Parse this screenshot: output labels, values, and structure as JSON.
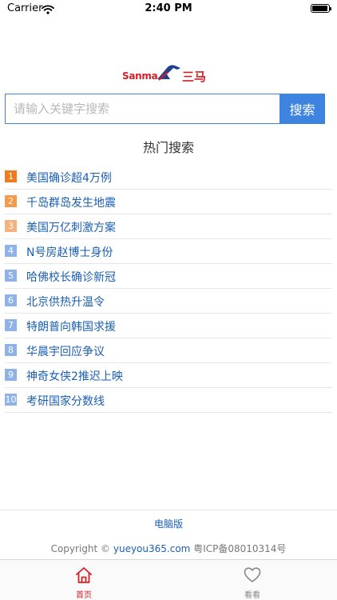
{
  "status_bar": {
    "carrier": "Carrier",
    "time": "2:40 PM",
    "icons": [
      "wifi-icon",
      "battery-icon"
    ]
  },
  "logo": {
    "text_en": "Sanma",
    "text_cn": "三马",
    "icon": "horse-icon",
    "color": "#d61f26"
  },
  "search": {
    "placeholder": "请输入关键字搜索",
    "value": "",
    "button_label": "搜索",
    "accent_color": "#3d83e0"
  },
  "hot_title": "热门搜索",
  "hot_searches": [
    {
      "rank": "1",
      "label": "美国确诊超4万例",
      "color": "#f07a1c"
    },
    {
      "rank": "2",
      "label": "千岛群岛发生地震",
      "color": "#f49a4a"
    },
    {
      "rank": "3",
      "label": "美国万亿刺激方案",
      "color": "#f6b27a"
    },
    {
      "rank": "4",
      "label": "N号房赵博士身份",
      "color": "#8fb3e8"
    },
    {
      "rank": "5",
      "label": "哈佛校长确诊新冠",
      "color": "#8fb3e8"
    },
    {
      "rank": "6",
      "label": "北京供热升温令",
      "color": "#8fb3e8"
    },
    {
      "rank": "7",
      "label": "特朗普向韩国求援",
      "color": "#8fb3e8"
    },
    {
      "rank": "8",
      "label": "华晨宇回应争议",
      "color": "#8fb3e8"
    },
    {
      "rank": "9",
      "label": "神奇女侠2推迟上映",
      "color": "#8fb3e8"
    },
    {
      "rank": "10",
      "label": "考研国家分数线",
      "color": "#8fb3e8"
    }
  ],
  "footer": {
    "pc_version": "电脑版",
    "copyright_prefix": "Copyright ©",
    "site": "yueyou365.com",
    "icp": "粤ICP备08010314号"
  },
  "tab_bar": {
    "tabs": [
      {
        "label": "首页",
        "icon": "home-icon",
        "active": true,
        "color": "#d61f26"
      },
      {
        "label": "看看",
        "icon": "heart-icon",
        "active": false,
        "color": "#888888"
      }
    ]
  }
}
